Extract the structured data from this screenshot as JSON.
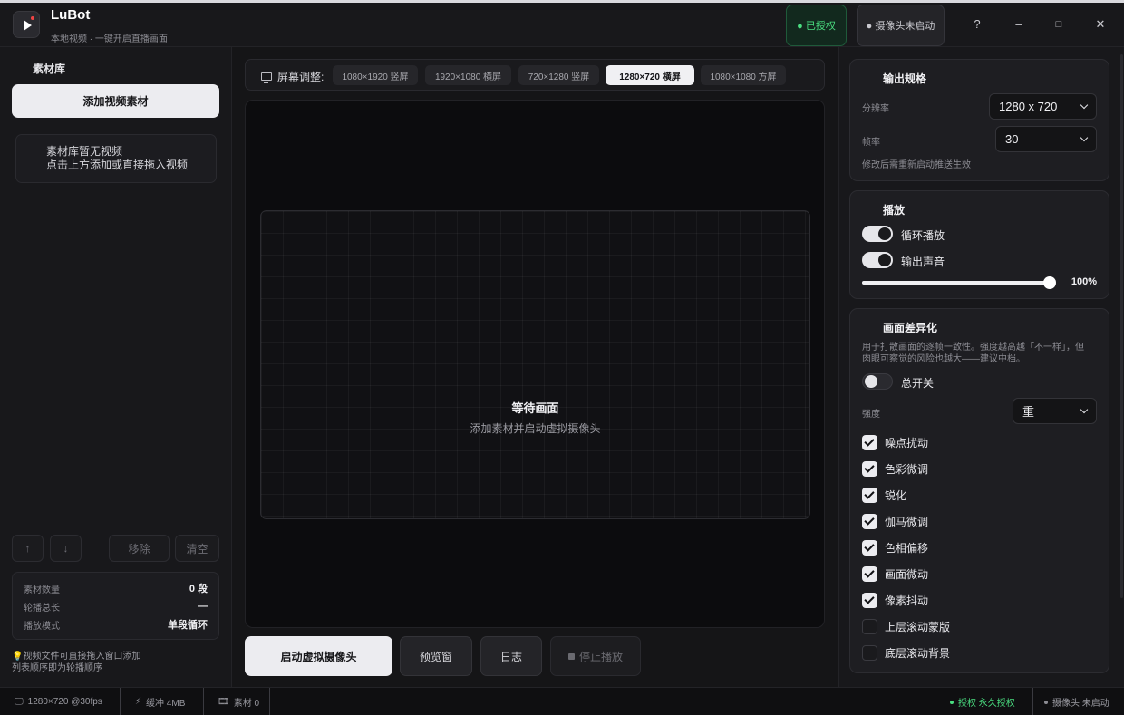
{
  "app": {
    "title": "LuBot",
    "subtitle": "本地视频 · 一键开启直播画面"
  },
  "header": {
    "auth_badge": "● 已授权",
    "camera_badge": "● 摄像头未启动",
    "help": "?",
    "minimize": "–",
    "maximize": "□",
    "close": "✕"
  },
  "library": {
    "title": "素材库",
    "add_button": "添加视频素材",
    "empty_line1": "素材库暂无视频",
    "empty_line2": "点击上方添加或直接拖入视频",
    "up_label": "↑",
    "down_label": "↓",
    "remove_label": "移除",
    "clear_label": "清空",
    "stats": [
      {
        "label": "素材数量",
        "value": "0 段"
      },
      {
        "label": "轮播总长",
        "value": "—"
      },
      {
        "label": "播放模式",
        "value": "单段循环"
      }
    ],
    "hint_line1": "视频文件可直接拖入窗口添加",
    "hint_line2": "列表顺序即为轮播顺序"
  },
  "screen": {
    "label": "屏幕调整:",
    "options": [
      "1080×1920 竖屏",
      "1920×1080 横屏",
      "720×1280 竖屏",
      "1280×720 横屏",
      "1080×1080 方屏"
    ],
    "active_index": 3
  },
  "preview": {
    "title": "等待画面",
    "subtitle": "添加素材并启动虚拟摄像头"
  },
  "actions": {
    "start": "启动虚拟摄像头",
    "preview": "预览窗",
    "log": "日志",
    "stop": "停止播放"
  },
  "output": {
    "title": "输出规格",
    "resolution_label": "分辨率",
    "resolution_value": "1280 x 720",
    "fps_label": "帧率",
    "fps_value": "30",
    "note": "修改后需重新启动推送生效"
  },
  "playback": {
    "title": "播放",
    "loop_label": "循环播放",
    "loop_on": true,
    "audio_label": "输出声音",
    "audio_on": true,
    "volume": 100,
    "volume_label": "100%"
  },
  "diff": {
    "title": "画面差异化",
    "desc_line1": "用于打散画面的逐帧一致性。强度越高越「不一样」，但",
    "desc_line2": "肉眼可察觉的风险也越大——建议中档。",
    "master_label": "总开关",
    "master_on": false,
    "strength_label": "强度",
    "strength_value": "重",
    "options": [
      {
        "label": "噪点扰动",
        "checked": true
      },
      {
        "label": "色彩微调",
        "checked": true
      },
      {
        "label": "锐化",
        "checked": true
      },
      {
        "label": "伽马微调",
        "checked": true
      },
      {
        "label": "色相偏移",
        "checked": true
      },
      {
        "label": "画面微动",
        "checked": true
      },
      {
        "label": "像素抖动",
        "checked": true
      },
      {
        "label": "上层滚动蒙版",
        "checked": false
      },
      {
        "label": "底层滚动背景",
        "checked": false
      }
    ]
  },
  "statusbar": {
    "resolution": "1280×720 @30fps",
    "buffer": "缓冲 4MB",
    "assets": "素材 0",
    "license": "授权 永久授权",
    "camera": "摄像头 未启动"
  },
  "colors": {
    "accent_green": "#4ade80",
    "background": "#151517",
    "primary_button": "#ececf0"
  }
}
